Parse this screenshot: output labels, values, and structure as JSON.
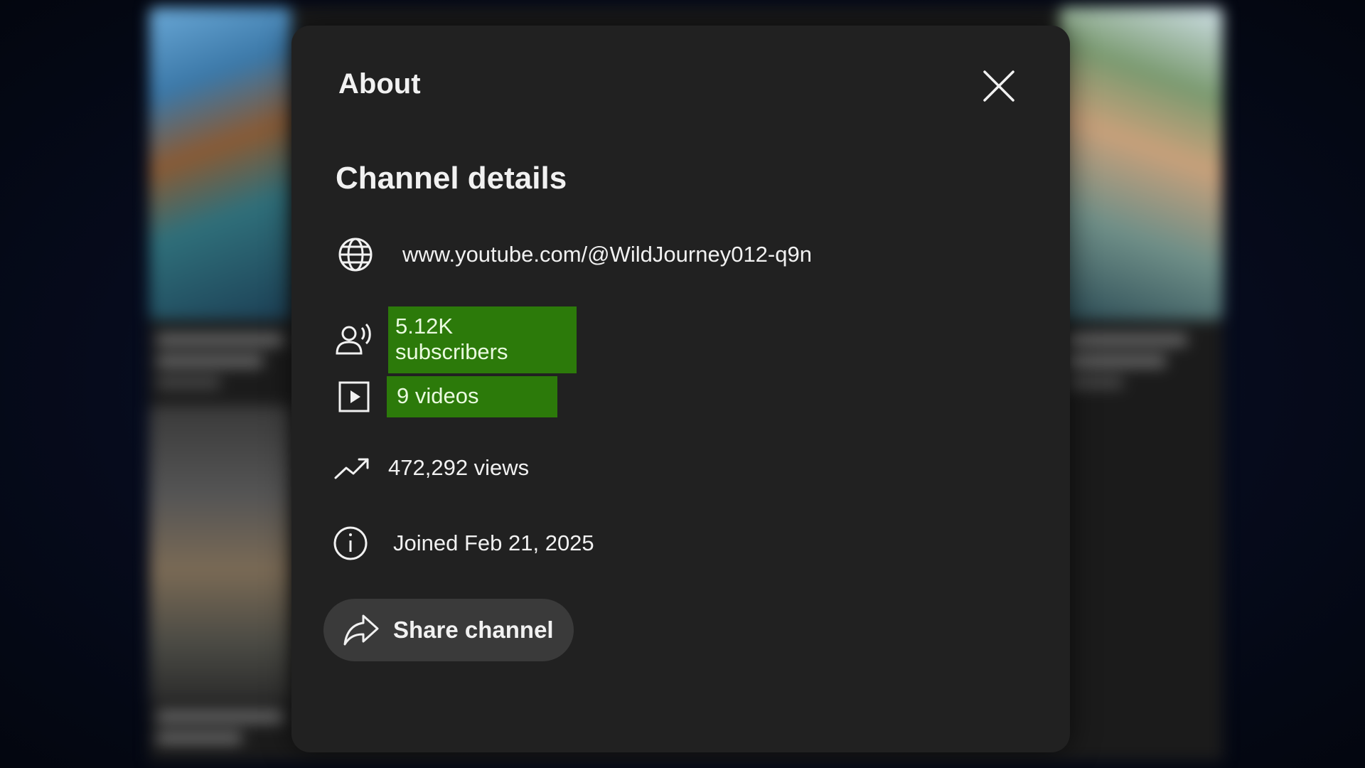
{
  "modal": {
    "title": "About",
    "close_icon": "close-icon"
  },
  "channel_details": {
    "heading": "Channel details",
    "url": "www.youtube.com/@WildJourney012-q9n",
    "subscribers": "5.12K subscribers",
    "videos": "9 videos",
    "views": "472,292 views",
    "joined": "Joined Feb 21, 2025",
    "icons": {
      "url": "globe-icon",
      "subscribers": "people-icon",
      "videos": "play-box-icon",
      "views": "trending-up-icon",
      "joined": "info-icon"
    },
    "highlight_color": "#2c7a0a"
  },
  "share": {
    "label": "Share channel",
    "icon": "share-arrow-icon"
  },
  "colors": {
    "modal_bg": "#212121",
    "button_bg": "#3a3a3a",
    "text": "#f1f1f1"
  }
}
